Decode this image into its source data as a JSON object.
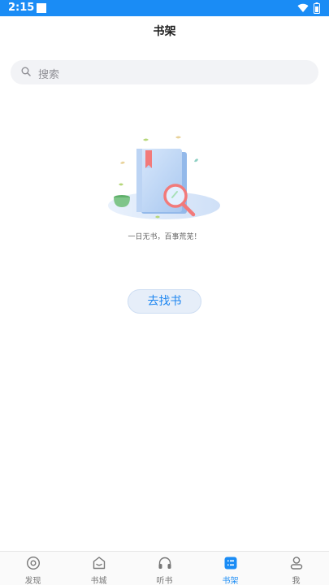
{
  "status_bar": {
    "time": "2:15"
  },
  "header": {
    "title": "书架"
  },
  "search": {
    "placeholder": "搜索"
  },
  "empty_state": {
    "message": "一日无书，百事荒芜！"
  },
  "actions": {
    "find_book_label": "去找书"
  },
  "tab_bar": {
    "active_color": "#1a8cf5",
    "tabs": [
      {
        "label": "发现",
        "icon": "compass-icon"
      },
      {
        "label": "书城",
        "icon": "bookstore-icon"
      },
      {
        "label": "听书",
        "icon": "headphones-icon"
      },
      {
        "label": "书架",
        "icon": "bookshelf-icon",
        "active": true
      },
      {
        "label": "我",
        "icon": "user-icon"
      }
    ]
  }
}
